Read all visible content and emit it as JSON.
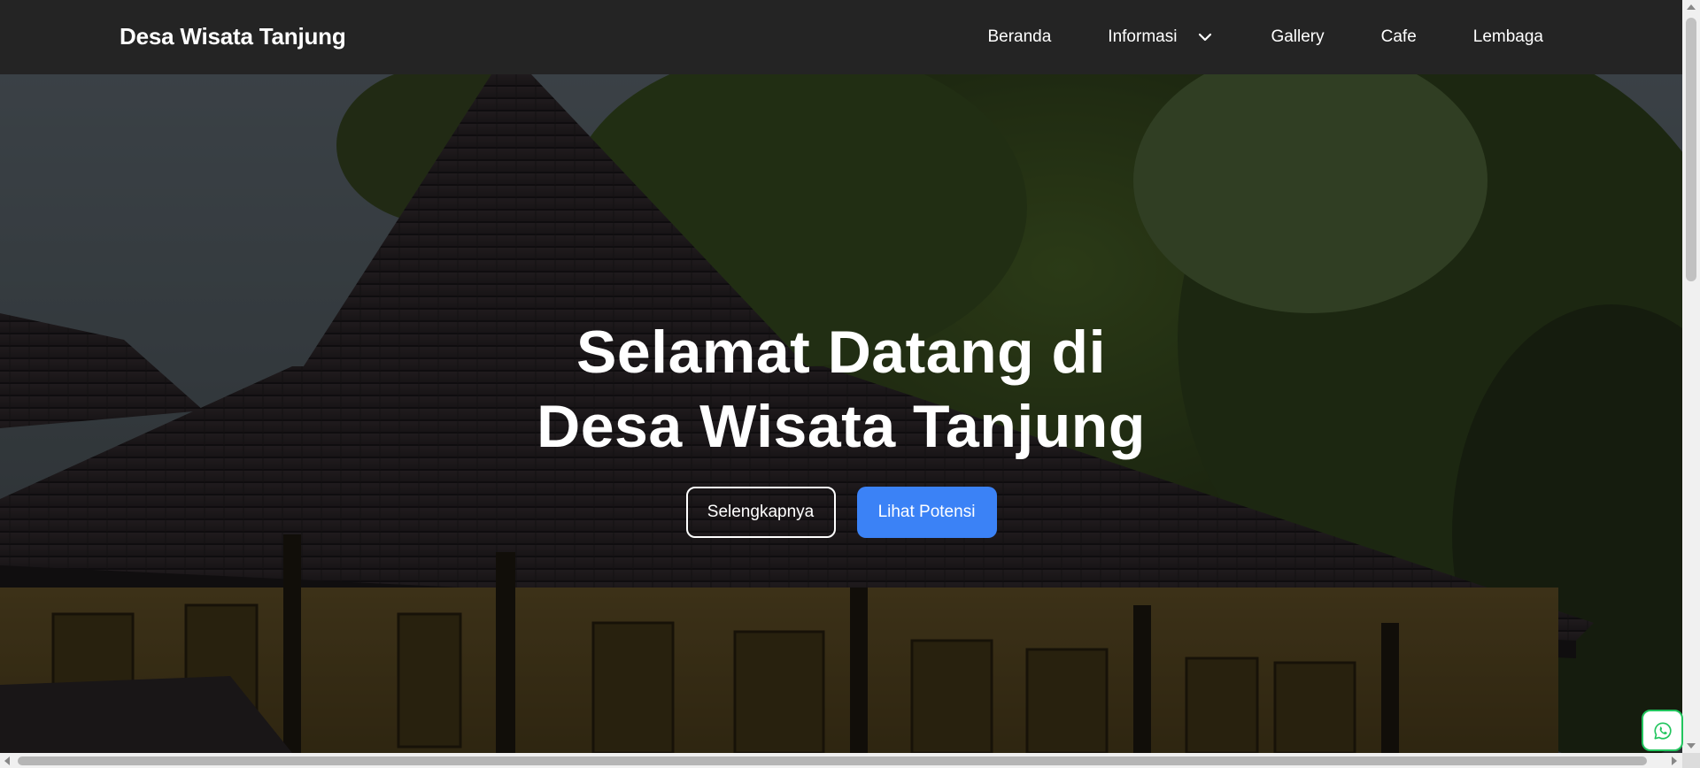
{
  "navbar": {
    "brand": "Desa Wisata Tanjung",
    "links": [
      {
        "label": "Beranda"
      },
      {
        "label": "Informasi",
        "icon": "chevron-down-icon"
      },
      {
        "label": "Gallery"
      },
      {
        "label": "Cafe"
      },
      {
        "label": "Lembaga"
      }
    ]
  },
  "hero": {
    "title_line1": "Selamat Datang di",
    "title_line2": "Desa Wisata Tanjung",
    "button_secondary": "Selengkapnya",
    "button_primary": "Lihat Potensi",
    "background": "traditional Javanese joglo house with trees"
  },
  "floating": {
    "whatsapp_icon": "whatsapp-icon"
  },
  "colors": {
    "navbar_bg": "#242424",
    "primary_button": "#3b82f6",
    "whatsapp_border": "#22c55e"
  }
}
